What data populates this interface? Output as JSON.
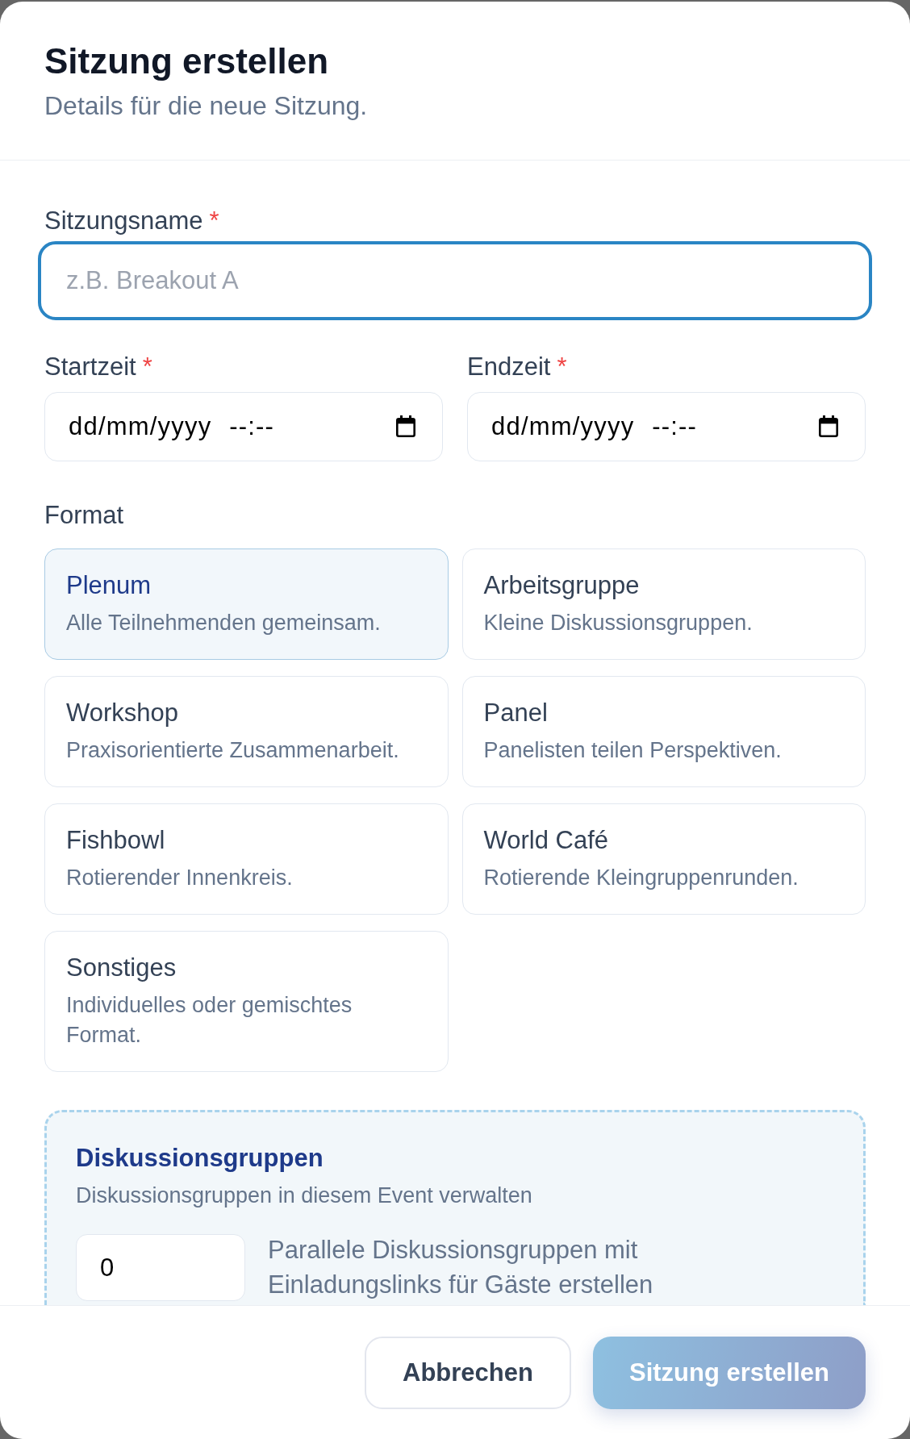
{
  "dialog": {
    "title": "Sitzung erstellen",
    "subtitle": "Details für die neue Sitzung."
  },
  "name_field": {
    "label": "Sitzungsname",
    "required_mark": "*",
    "placeholder": "z.B. Breakout A",
    "focused": true
  },
  "time_fields": [
    {
      "label": "Startzeit",
      "required_mark": "*",
      "placeholder": "dd/mm/yyyy --:--"
    },
    {
      "label": "Endzeit",
      "required_mark": "*",
      "placeholder": "dd/mm/yyyy --:--"
    }
  ],
  "format": {
    "label": "Format",
    "options": [
      {
        "title": "Plenum",
        "description": "Alle Teilnehmenden gemeinsam.",
        "selected": true
      },
      {
        "title": "Arbeitsgruppe",
        "description": "Kleine Diskussionsgruppen.",
        "selected": false
      },
      {
        "title": "Workshop",
        "description": "Praxisorientierte Zusammenarbeit.",
        "selected": false
      },
      {
        "title": "Panel",
        "description": "Panelisten teilen Perspektiven.",
        "selected": false
      },
      {
        "title": "Fishbowl",
        "description": "Rotierender Innenkreis.",
        "selected": false
      },
      {
        "title": "World Café",
        "description": "Rotierende Kleingruppenrunden.",
        "selected": false
      },
      {
        "title": "Sonstiges",
        "description": "Individuelles oder gemischtes Format.",
        "selected": false
      }
    ]
  },
  "discussion_groups": {
    "title": "Diskussionsgruppen",
    "subtitle": "Diskussionsgruppen in diesem Event verwalten",
    "count_field": {
      "value": "0"
    },
    "hint": "Parallele Diskussionsgruppen mit Einladungslinks für Gäste erstellen"
  },
  "footer_buttons": [
    {
      "label": "Abbrechen",
      "kind": "secondary",
      "disabled": false
    },
    {
      "label": "Sitzung erstellen",
      "kind": "primary",
      "disabled": true
    }
  ]
}
